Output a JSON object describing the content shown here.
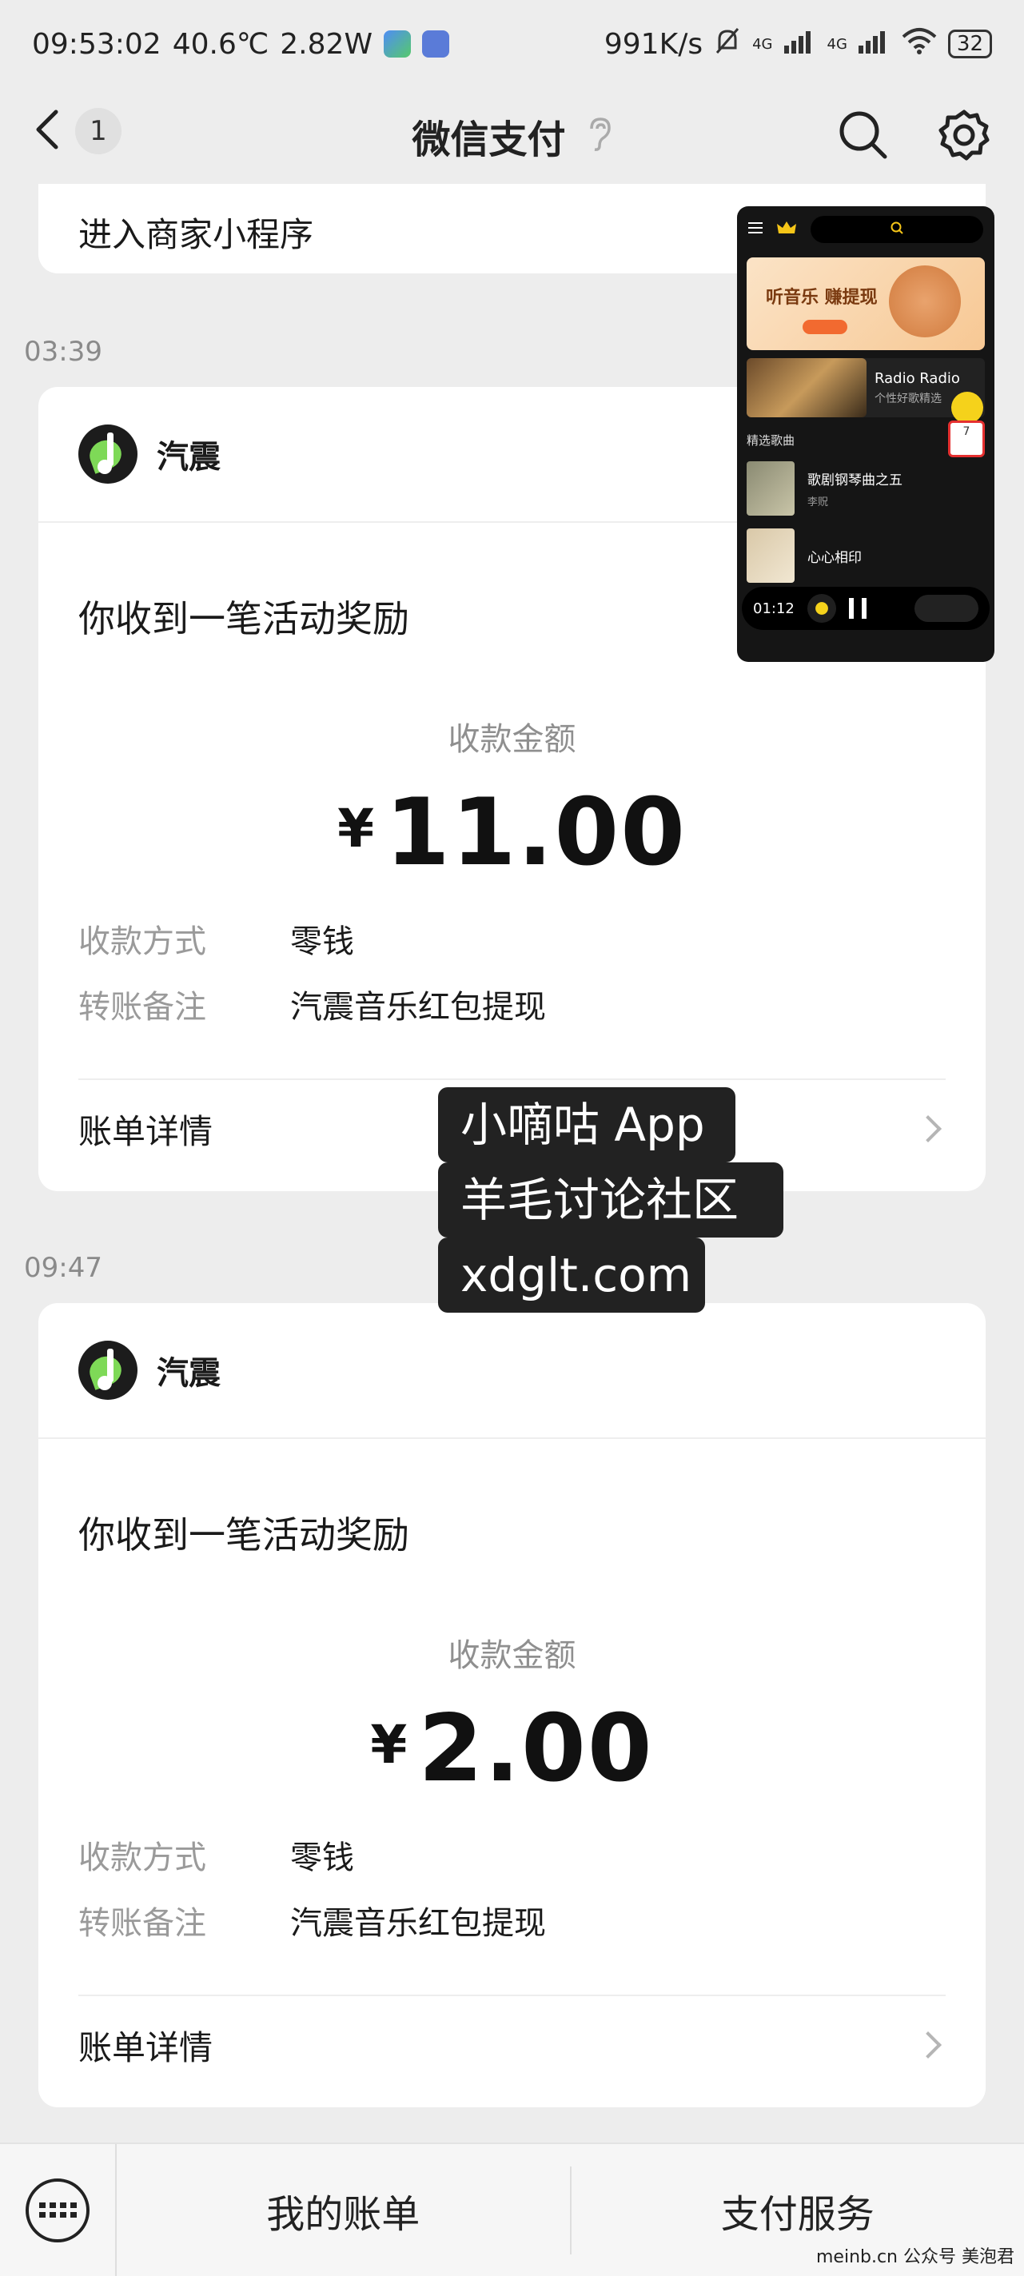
{
  "status_bar": {
    "time": "09:53:02",
    "temperature": "40.6℃",
    "power": "2.82W",
    "net_speed": "991K/s",
    "signal_1": "4G",
    "signal_2": "4G",
    "battery": "32"
  },
  "nav": {
    "badge": "1",
    "title": "微信支付"
  },
  "top_card": {
    "label": "进入商家小程序"
  },
  "mini_player": {
    "banner_title": "听音乐 赚提现",
    "radio_title": "Radio Radio",
    "radio_sub": "个性好歌精选",
    "tag": "7",
    "section": "精选歌曲",
    "songs": [
      {
        "title": "歌剧钢琴曲之五",
        "artist": "李贶"
      },
      {
        "title": "心心相印",
        "artist": ""
      }
    ],
    "elapsed": "01:12"
  },
  "messages": [
    {
      "time": "03:39",
      "merchant": "汽震",
      "headline": "你收到一笔活动奖励",
      "amount_label": "收款金额",
      "currency": "¥",
      "amount": "11.00",
      "method_label": "收款方式",
      "method": "零钱",
      "note_label": "转账备注",
      "note": "汽震音乐红包提现",
      "detail": "账单详情"
    },
    {
      "time": "09:47",
      "merchant": "汽震",
      "headline": "你收到一笔活动奖励",
      "amount_label": "收款金额",
      "currency": "¥",
      "amount": "2.00",
      "method_label": "收款方式",
      "method": "零钱",
      "note_label": "转账备注",
      "note": "汽震音乐红包提现",
      "detail": "账单详情"
    }
  ],
  "watermark": {
    "line1": "小嘀咕 App",
    "line2": "羊毛讨论社区",
    "line3": "xdglt.com"
  },
  "bottom_bar": {
    "tab1": "我的账单",
    "tab2": "支付服务"
  },
  "credit": "meinb.cn 公众号 美泡君",
  "colors": {
    "background": "#ededed",
    "card": "#ffffff",
    "accent_green": "#7ed957"
  }
}
